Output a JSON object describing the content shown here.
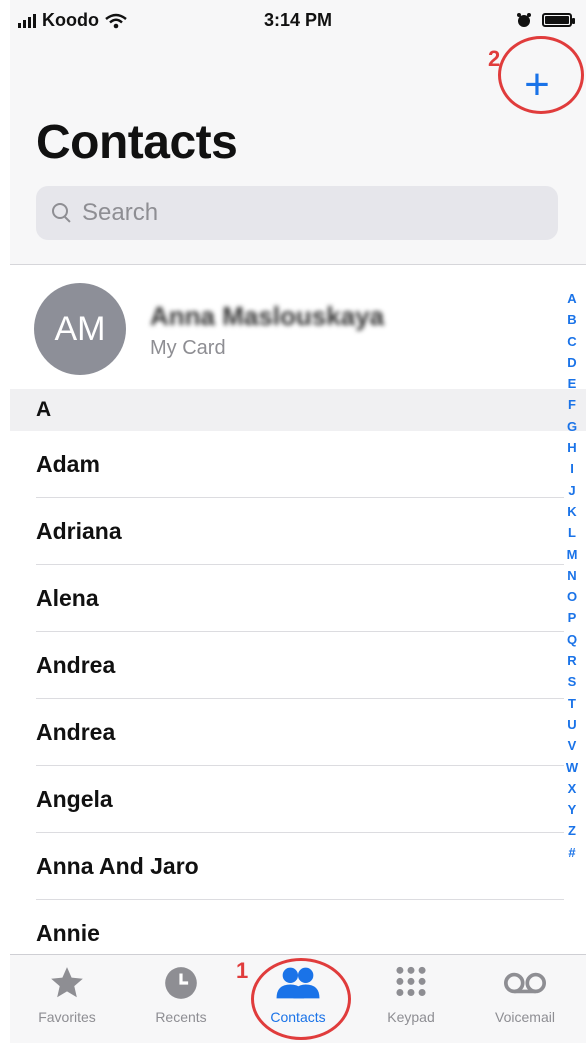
{
  "status_bar": {
    "carrier": "Koodo",
    "time": "3:14 PM"
  },
  "header": {
    "title": "Contacts",
    "add_symbol": "+"
  },
  "search": {
    "placeholder": "Search"
  },
  "my_card": {
    "initials": "AM",
    "name": "Anna Maslouskaya",
    "subtitle": "My Card"
  },
  "section_header": "A",
  "contacts": [
    "Adam",
    "Adriana",
    "Alena",
    "Andrea",
    "Andrea",
    "Angela",
    "Anna And Jaro",
    "Annie"
  ],
  "index_letters": [
    "A",
    "B",
    "C",
    "D",
    "E",
    "F",
    "G",
    "H",
    "I",
    "J",
    "K",
    "L",
    "M",
    "N",
    "O",
    "P",
    "Q",
    "R",
    "S",
    "T",
    "U",
    "V",
    "W",
    "X",
    "Y",
    "Z",
    "#"
  ],
  "annotations": {
    "step1": "1",
    "step2": "2"
  },
  "tabs": [
    {
      "label": "Favorites",
      "icon": "star-icon"
    },
    {
      "label": "Recents",
      "icon": "clock-icon"
    },
    {
      "label": "Contacts",
      "icon": "people-icon",
      "active": true
    },
    {
      "label": "Keypad",
      "icon": "keypad-icon"
    },
    {
      "label": "Voicemail",
      "icon": "voicemail-icon"
    }
  ],
  "colors": {
    "accent": "#1a73e8",
    "annotation": "#e03c3c",
    "inactive": "#8e8e93"
  }
}
